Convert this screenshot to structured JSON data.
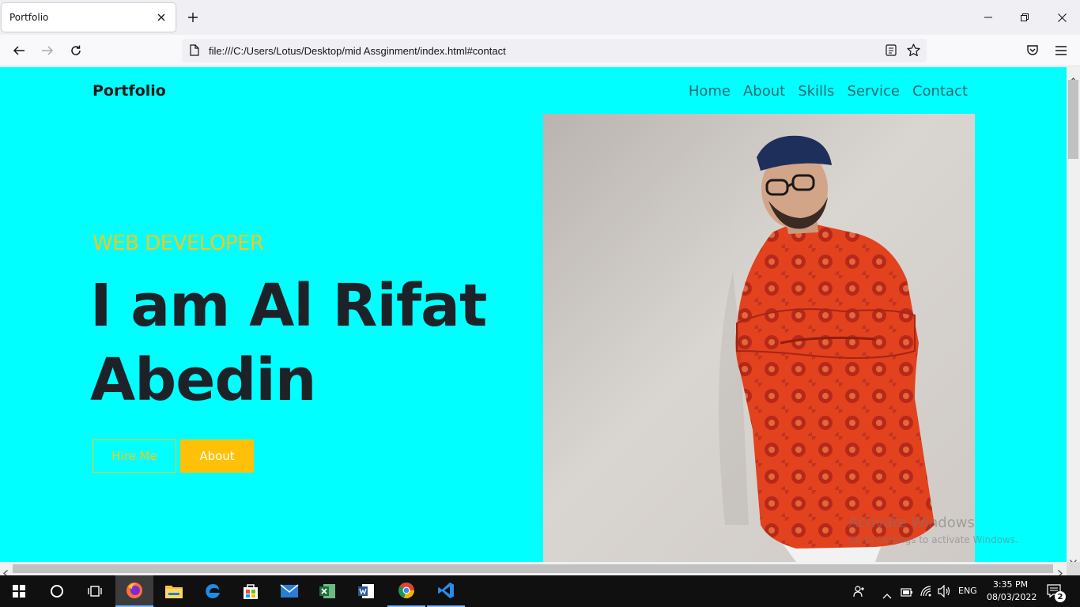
{
  "browser": {
    "tab_title": "Portfolio",
    "url": "file:///C:/Users/Lotus/Desktop/mid Assginment/index.html#contact"
  },
  "page": {
    "brand": "Portfolio",
    "nav": [
      "Home",
      "About",
      "Skills",
      "Service",
      "Contact"
    ],
    "subtitle": "WEB DEVELOPER",
    "headline_line1": "I am Al Rifat",
    "headline_line2": "Abedin",
    "hire_button": "Hire Me",
    "about_button": "About",
    "colors": {
      "background": "#00ffff",
      "accent": "#ffc107",
      "text": "#1d2228"
    }
  },
  "watermark": {
    "line1": "Activate Windows",
    "line2": "Go to Settings to activate Windows."
  },
  "taskbar": {
    "language": "ENG",
    "time": "3:35 PM",
    "date": "08/03/2022",
    "notification_count": "2",
    "apps": [
      "start-icon",
      "search-icon",
      "task-view-icon",
      "firefox-icon",
      "file-explorer-icon",
      "edge-icon",
      "store-icon",
      "mail-icon",
      "excel-icon",
      "word-icon",
      "chrome-icon",
      "vscode-icon"
    ]
  }
}
